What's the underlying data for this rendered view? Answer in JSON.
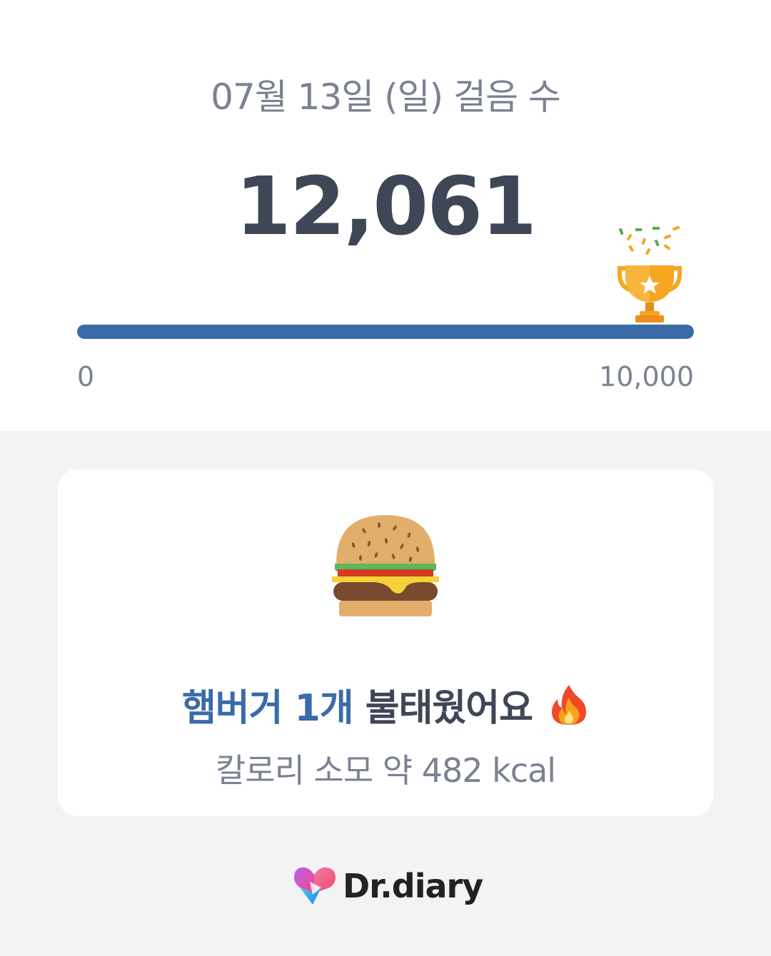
{
  "header": {
    "date_title": "07월 13일 (일) 걸음 수",
    "step_count": "12,061"
  },
  "progress": {
    "min_label": "0",
    "max_label": "10,000",
    "fraction": 1.0,
    "goal_reached": true,
    "bar_color": "#3a6aa8"
  },
  "card": {
    "food_icon": "hamburger-icon",
    "headline_highlight": "햄버거 1개",
    "headline_rest": "불태웠어요",
    "headline_icon": "fire-icon",
    "calorie_text": "칼로리 소모 약 482 kcal",
    "highlight_color": "#3a6aa8"
  },
  "brand": {
    "logo_icon": "heart-logo-icon",
    "name": "Dr.diary"
  }
}
